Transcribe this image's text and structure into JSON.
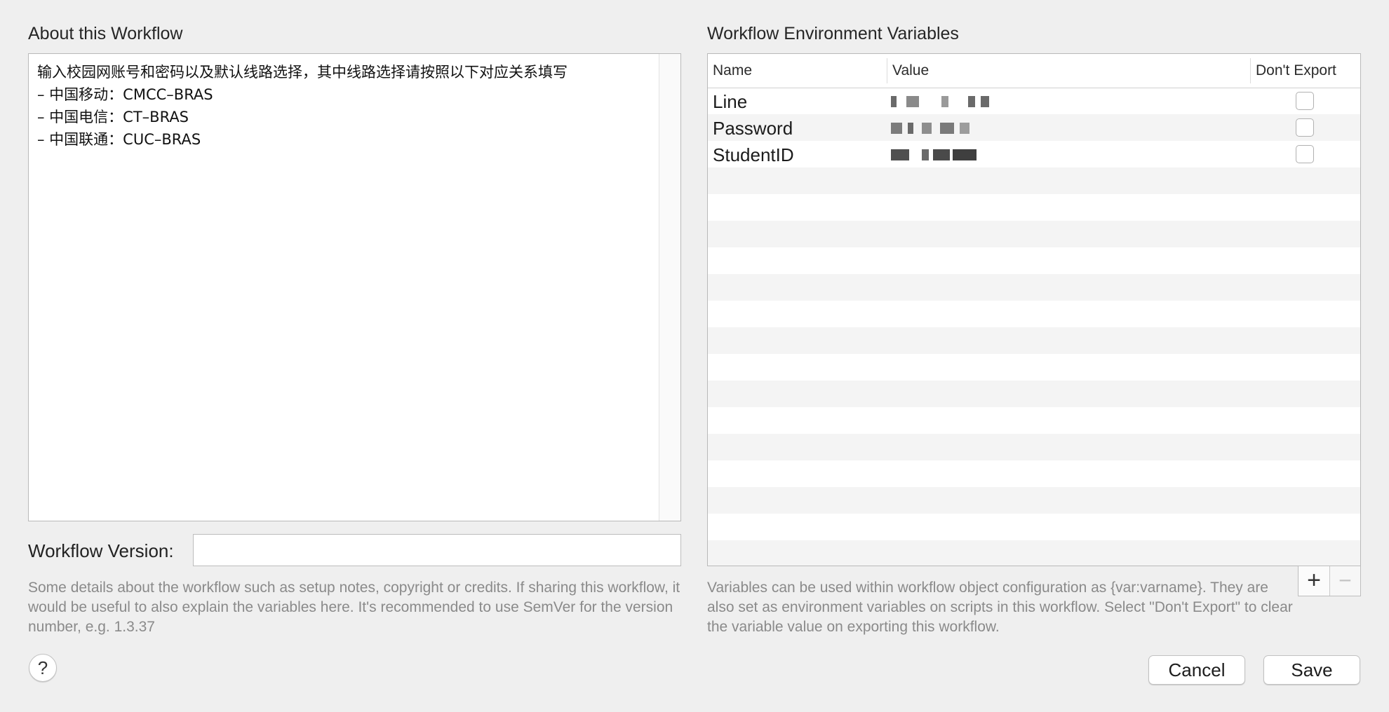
{
  "about": {
    "title": "About this Workflow",
    "lines": [
      "输入校园网账号和密码以及默认线路选择，其中线路选择请按照以下对应关系填写",
      "– 中国移动：CMCC–BRAS",
      "– 中国电信：CT–BRAS",
      "– 中国联通：CUC–BRAS"
    ],
    "version_label": "Workflow Version:",
    "version_value": "",
    "help": "Some details about the workflow such as setup notes, copyright or credits. If sharing this workflow, it would be useful to also explain the variables here. It's recommended to use SemVer for the version number, e.g. 1.3.37"
  },
  "env": {
    "title": "Workflow Environment Variables",
    "columns": [
      "Name",
      "Value",
      "Don't Export"
    ],
    "rows": [
      {
        "name": "Line",
        "value_redacted": true,
        "dont_export": false
      },
      {
        "name": "Password",
        "value_redacted": true,
        "dont_export": false
      },
      {
        "name": "StudentID",
        "value_redacted": true,
        "dont_export": false
      }
    ],
    "add_label": "+",
    "remove_label": "−",
    "help": "Variables can be used within workflow object configuration as {var:varname}. They are also set as environment variables on scripts in this workflow. Select \"Don't Export\" to clear the variable value on exporting this workflow."
  },
  "buttons": {
    "help": "?",
    "cancel": "Cancel",
    "save": "Save"
  }
}
